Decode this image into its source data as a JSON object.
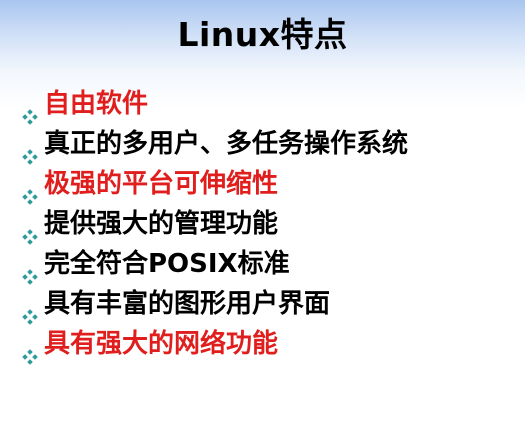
{
  "title": "Linux特点",
  "colors": {
    "bullet_icon": "#2f9a9a",
    "text_default": "#000000",
    "text_highlight": "#e01e1e"
  },
  "bullets": [
    {
      "text": "自由软件",
      "highlight": true
    },
    {
      "text": "真正的多用户、多任务操作系统",
      "highlight": false
    },
    {
      "text": "极强的平台可伸缩性",
      "highlight": true
    },
    {
      "text": "提供强大的管理功能",
      "highlight": false
    },
    {
      "text": "完全符合POSIX标准",
      "highlight": false
    },
    {
      "text": "具有丰富的图形用户界面",
      "highlight": false
    },
    {
      "text": "具有强大的网络功能",
      "highlight": true
    }
  ]
}
